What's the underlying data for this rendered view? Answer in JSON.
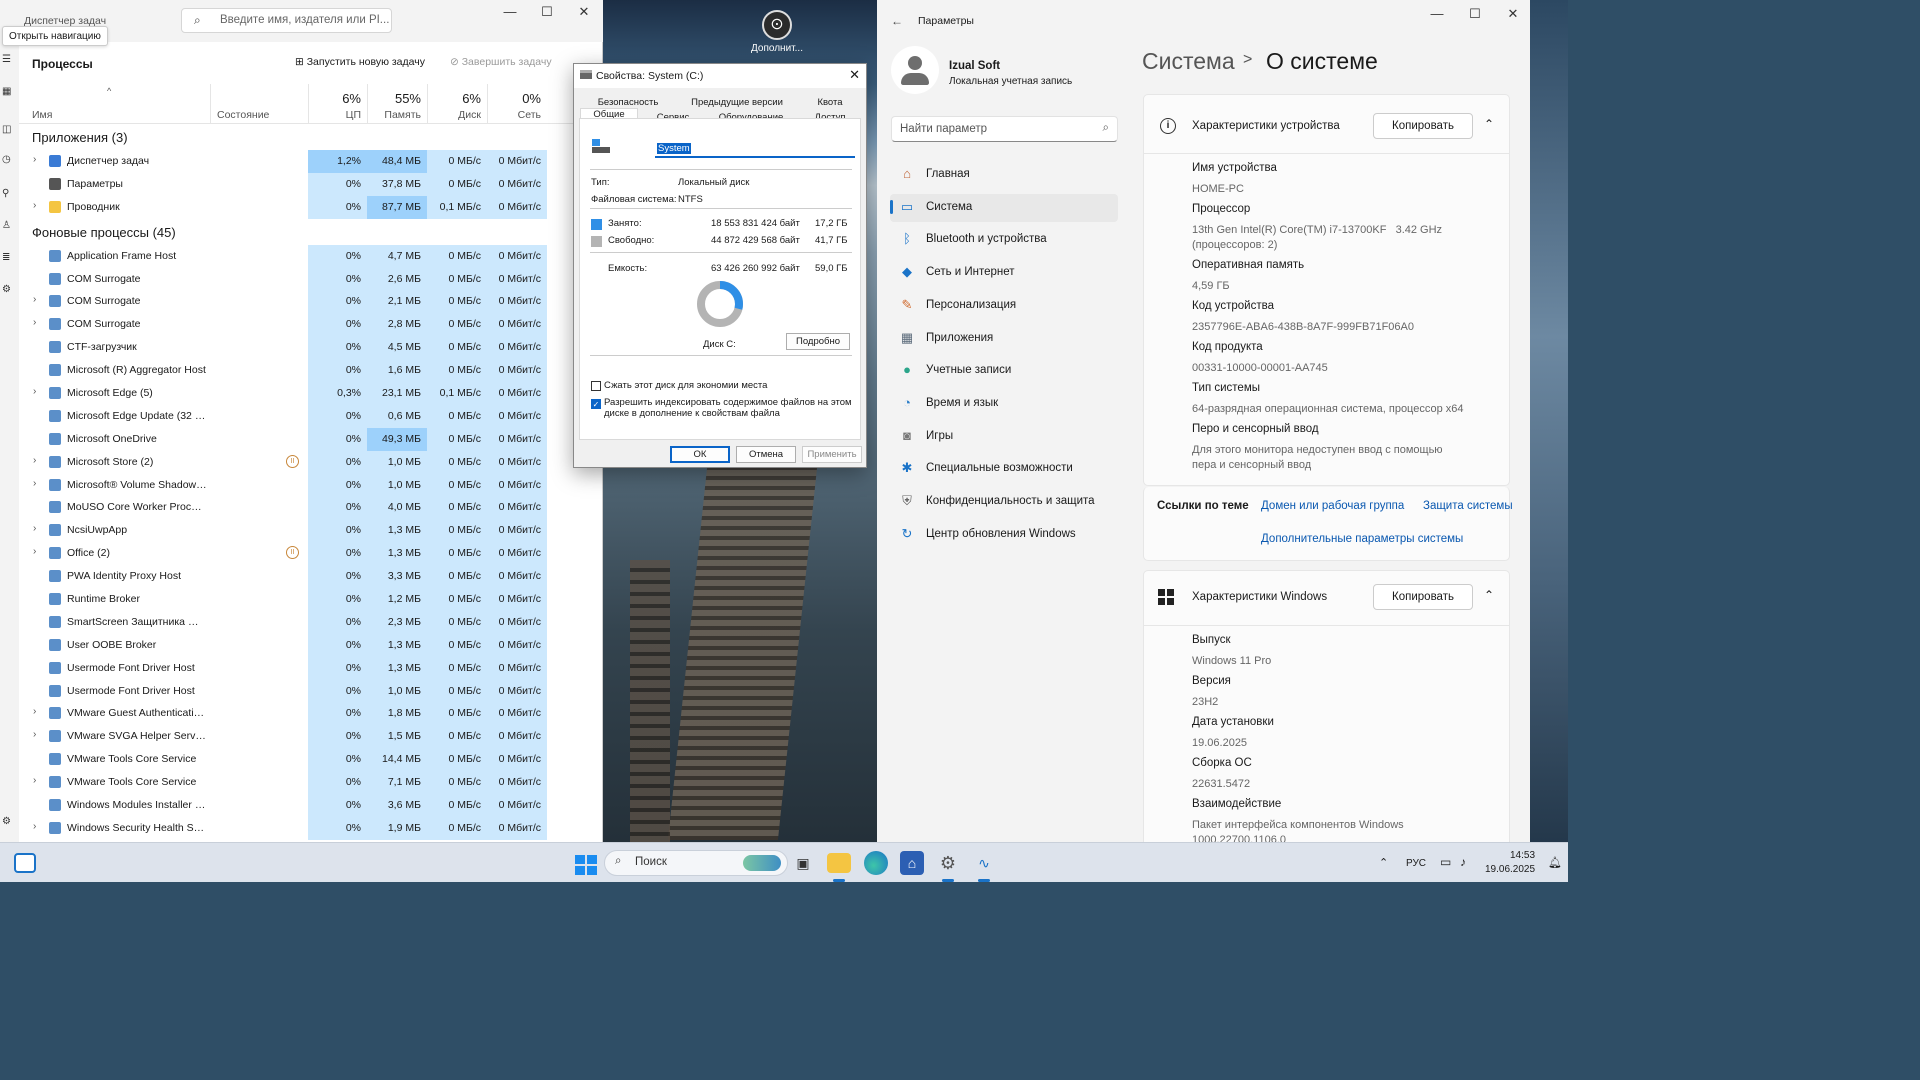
{
  "taskmgr": {
    "title": "Диспетчер задач",
    "search_placeholder": "Введите имя, издателя или PI...",
    "tooltip": "Открыть навигацию",
    "section": "Процессы",
    "run_new": "Запустить новую задачу",
    "end_task": "Завершить задачу",
    "columns": {
      "name": "Имя",
      "status": "Состояние",
      "cpu_pct": "6%",
      "cpu": "ЦП",
      "mem_pct": "55%",
      "mem": "Память",
      "disk_pct": "6%",
      "disk": "Диск",
      "net_pct": "0%",
      "net": "Сеть"
    },
    "groups": {
      "apps": "Приложения (3)",
      "bg": "Фоновые процессы (45)"
    },
    "apps": [
      {
        "name": "Диспетчер задач",
        "cpu": "1,2%",
        "mem": "48,4 МБ",
        "disk": "0 МБ/с",
        "net": "0 Мбит/с",
        "expand": true,
        "icon": "taskmgr-icon",
        "color": "#3a7bd5"
      },
      {
        "name": "Параметры",
        "cpu": "0%",
        "mem": "37,8 МБ",
        "disk": "0 МБ/с",
        "net": "0 Мбит/с",
        "expand": false,
        "icon": "settings-icon",
        "color": "#555"
      },
      {
        "name": "Проводник",
        "cpu": "0%",
        "mem": "87,7 МБ",
        "disk": "0,1 МБ/с",
        "net": "0 Мбит/с",
        "expand": true,
        "icon": "folder-icon",
        "color": "#f4c542"
      }
    ],
    "background": [
      {
        "name": "Application Frame Host",
        "cpu": "0%",
        "mem": "4,7 МБ",
        "disk": "0 МБ/с",
        "net": "0 Мбит/с",
        "expand": false
      },
      {
        "name": "COM Surrogate",
        "cpu": "0%",
        "mem": "2,6 МБ",
        "disk": "0 МБ/с",
        "net": "0 Мбит/с",
        "expand": false
      },
      {
        "name": "COM Surrogate",
        "cpu": "0%",
        "mem": "2,1 МБ",
        "disk": "0 МБ/с",
        "net": "0 Мбит/с",
        "expand": true
      },
      {
        "name": "COM Surrogate",
        "cpu": "0%",
        "mem": "2,8 МБ",
        "disk": "0 МБ/с",
        "net": "0 Мбит/с",
        "expand": true
      },
      {
        "name": "CTF-загрузчик",
        "cpu": "0%",
        "mem": "4,5 МБ",
        "disk": "0 МБ/с",
        "net": "0 Мбит/с",
        "expand": false
      },
      {
        "name": "Microsoft (R) Aggregator Host",
        "cpu": "0%",
        "mem": "1,6 МБ",
        "disk": "0 МБ/с",
        "net": "0 Мбит/с",
        "expand": false
      },
      {
        "name": "Microsoft Edge (5)",
        "cpu": "0,3%",
        "mem": "23,1 МБ",
        "disk": "0,1 МБ/с",
        "net": "0 Мбит/с",
        "expand": true
      },
      {
        "name": "Microsoft Edge Update (32 би...",
        "cpu": "0%",
        "mem": "0,6 МБ",
        "disk": "0 МБ/с",
        "net": "0 Мбит/с",
        "expand": false
      },
      {
        "name": "Microsoft OneDrive",
        "cpu": "0%",
        "mem": "49,3 МБ",
        "disk": "0 МБ/с",
        "net": "0 Мбит/с",
        "expand": false,
        "hi": true
      },
      {
        "name": "Microsoft Store (2)",
        "cpu": "0%",
        "mem": "1,0 МБ",
        "disk": "0 МБ/с",
        "net": "0 Мбит/с",
        "expand": true,
        "suspended": true
      },
      {
        "name": "Microsoft® Volume Shadow ...",
        "cpu": "0%",
        "mem": "1,0 МБ",
        "disk": "0 МБ/с",
        "net": "0 Мбит/с",
        "expand": true
      },
      {
        "name": "MoUSO Core Worker Process",
        "cpu": "0%",
        "mem": "4,0 МБ",
        "disk": "0 МБ/с",
        "net": "0 Мбит/с",
        "expand": false
      },
      {
        "name": "NcsiUwpApp",
        "cpu": "0%",
        "mem": "1,3 МБ",
        "disk": "0 МБ/с",
        "net": "0 Мбит/с",
        "expand": true
      },
      {
        "name": "Office (2)",
        "cpu": "0%",
        "mem": "1,3 МБ",
        "disk": "0 МБ/с",
        "net": "0 Мбит/с",
        "expand": true,
        "suspended": true
      },
      {
        "name": "PWA Identity Proxy Host",
        "cpu": "0%",
        "mem": "3,3 МБ",
        "disk": "0 МБ/с",
        "net": "0 Мбит/с",
        "expand": false
      },
      {
        "name": "Runtime Broker",
        "cpu": "0%",
        "mem": "1,2 МБ",
        "disk": "0 МБ/с",
        "net": "0 Мбит/с",
        "expand": false
      },
      {
        "name": "SmartScreen Защитника Win...",
        "cpu": "0%",
        "mem": "2,3 МБ",
        "disk": "0 МБ/с",
        "net": "0 Мбит/с",
        "expand": false
      },
      {
        "name": "User OOBE Broker",
        "cpu": "0%",
        "mem": "1,3 МБ",
        "disk": "0 МБ/с",
        "net": "0 Мбит/с",
        "expand": false
      },
      {
        "name": "Usermode Font Driver Host",
        "cpu": "0%",
        "mem": "1,3 МБ",
        "disk": "0 МБ/с",
        "net": "0 Мбит/с",
        "expand": false
      },
      {
        "name": "Usermode Font Driver Host",
        "cpu": "0%",
        "mem": "1,0 МБ",
        "disk": "0 МБ/с",
        "net": "0 Мбит/с",
        "expand": false
      },
      {
        "name": "VMware Guest Authentication...",
        "cpu": "0%",
        "mem": "1,8 МБ",
        "disk": "0 МБ/с",
        "net": "0 Мбит/с",
        "expand": true
      },
      {
        "name": "VMware SVGA Helper Service (...",
        "cpu": "0%",
        "mem": "1,5 МБ",
        "disk": "0 МБ/с",
        "net": "0 Мбит/с",
        "expand": true
      },
      {
        "name": "VMware Tools Core Service",
        "cpu": "0%",
        "mem": "14,4 МБ",
        "disk": "0 МБ/с",
        "net": "0 Мбит/с",
        "expand": false
      },
      {
        "name": "VMware Tools Core Service",
        "cpu": "0%",
        "mem": "7,1 МБ",
        "disk": "0 МБ/с",
        "net": "0 Мбит/с",
        "expand": true
      },
      {
        "name": "Windows Modules Installer W...",
        "cpu": "0%",
        "mem": "3,6 МБ",
        "disk": "0 МБ/с",
        "net": "0 Мбит/с",
        "expand": false
      },
      {
        "name": "Windows Security Health Servi...",
        "cpu": "0%",
        "mem": "1,9 МБ",
        "disk": "0 МБ/с",
        "net": "0 Мбит/с",
        "expand": true
      }
    ]
  },
  "desktop": {
    "icon_label": "Дополнит..."
  },
  "props": {
    "title": "Свойства: System (C:)",
    "tabs_row1": [
      "Безопасность",
      "Предыдущие версии",
      "Квота"
    ],
    "tabs_row2": [
      "Общие",
      "Сервис",
      "Оборудование",
      "Доступ"
    ],
    "name_value": "System",
    "type_label": "Тип:",
    "type_value": "Локальный диск",
    "fs_label": "Файловая система:",
    "fs_value": "NTFS",
    "used_label": "Занято:",
    "used_bytes": "18 553 831 424 байт",
    "used_gb": "17,2 ГБ",
    "free_label": "Свободно:",
    "free_bytes": "44 872 429 568 байт",
    "free_gb": "41,7 ГБ",
    "cap_label": "Емкость:",
    "cap_bytes": "63 426 260 992 байт",
    "cap_gb": "59,0 ГБ",
    "used_fraction": 0.29,
    "disk_label": "Диск C:",
    "details_btn": "Подробно",
    "compress_label": "Сжать этот диск для экономии места",
    "index_label": "Разрешить индексировать содержимое файлов на этом диске в дополнение к свойствам файла",
    "ok": "ОК",
    "cancel": "Отмена",
    "apply": "Применить",
    "used_color": "#2f8fe6",
    "free_color": "#b4b4b4"
  },
  "settings": {
    "title": "Параметры",
    "user_name": "Izual Soft",
    "user_type": "Локальная учетная запись",
    "search_placeholder": "Найти параметр",
    "nav": [
      {
        "label": "Главная",
        "icon": "home-icon",
        "glyph": "⌂",
        "color": "#c0663a"
      },
      {
        "label": "Система",
        "icon": "system-icon",
        "glyph": "▭",
        "color": "#1a73c8",
        "selected": true
      },
      {
        "label": "Bluetooth и устройства",
        "icon": "bluetooth-icon",
        "glyph": "ᛒ",
        "color": "#1a73c8"
      },
      {
        "label": "Сеть и Интернет",
        "icon": "wifi-icon",
        "glyph": "◆",
        "color": "#1a73c8"
      },
      {
        "label": "Персонализация",
        "icon": "brush-icon",
        "glyph": "✎",
        "color": "#d06a2e"
      },
      {
        "label": "Приложения",
        "icon": "apps-icon",
        "glyph": "▦",
        "color": "#5a6a7a"
      },
      {
        "label": "Учетные записи",
        "icon": "accounts-icon",
        "glyph": "●",
        "color": "#2ba58a"
      },
      {
        "label": "Время и язык",
        "icon": "clock-icon",
        "glyph": "◔",
        "color": "#2d7fc9"
      },
      {
        "label": "Игры",
        "icon": "gamepad-icon",
        "glyph": "◙",
        "color": "#777"
      },
      {
        "label": "Специальные возможности",
        "icon": "accessibility-icon",
        "glyph": "✱",
        "color": "#1a73c8"
      },
      {
        "label": "Конфиденциальность и защита",
        "icon": "shield-icon",
        "glyph": "⛨",
        "color": "#666"
      },
      {
        "label": "Центр обновления Windows",
        "icon": "update-icon",
        "glyph": "↻",
        "color": "#1a73c8"
      }
    ],
    "bc_parent": "Система",
    "bc_sep": ">",
    "bc_current": "О системе",
    "device_card": {
      "title": "Характеристики устройства",
      "copy": "Копировать",
      "fields": [
        {
          "k": "Имя устройства",
          "v": "HOME-PC"
        },
        {
          "k": "Процессор",
          "v": "13th Gen Intel(R) Core(TM) i7-13700KF   3.42 GHz\n(процессоров: 2)"
        },
        {
          "k": "Оперативная память",
          "v": "4,59 ГБ"
        },
        {
          "k": "Код устройства",
          "v": "2357796E-ABA6-438B-8A7F-999FB71F06A0"
        },
        {
          "k": "Код продукта",
          "v": "00331-10000-00001-AA745"
        },
        {
          "k": "Тип системы",
          "v": "64-разрядная операционная система, процессор x64"
        },
        {
          "k": "Перо и сенсорный ввод",
          "v": "Для этого монитора недоступен ввод с помощью\nпера и сенсорный ввод"
        }
      ]
    },
    "links": {
      "label": "Ссылки по теме",
      "l1": "Домен или рабочая группа",
      "l2": "Защита системы",
      "l3": "Дополнительные параметры системы"
    },
    "windows_card": {
      "title": "Характеристики Windows",
      "copy": "Копировать",
      "fields": [
        {
          "k": "Выпуск",
          "v": "Windows 11 Pro"
        },
        {
          "k": "Версия",
          "v": "23H2"
        },
        {
          "k": "Дата установки",
          "v": "19.06.2025"
        },
        {
          "k": "Сборка ОС",
          "v": "22631.5472"
        },
        {
          "k": "Взаимодействие",
          "v": "Пакет интерфейса компонентов Windows\n1000.22700.1106.0"
        }
      ]
    }
  },
  "taskbar": {
    "search": "Поиск",
    "lang": "РУС",
    "time": "14:53",
    "date": "19.06.2025"
  }
}
